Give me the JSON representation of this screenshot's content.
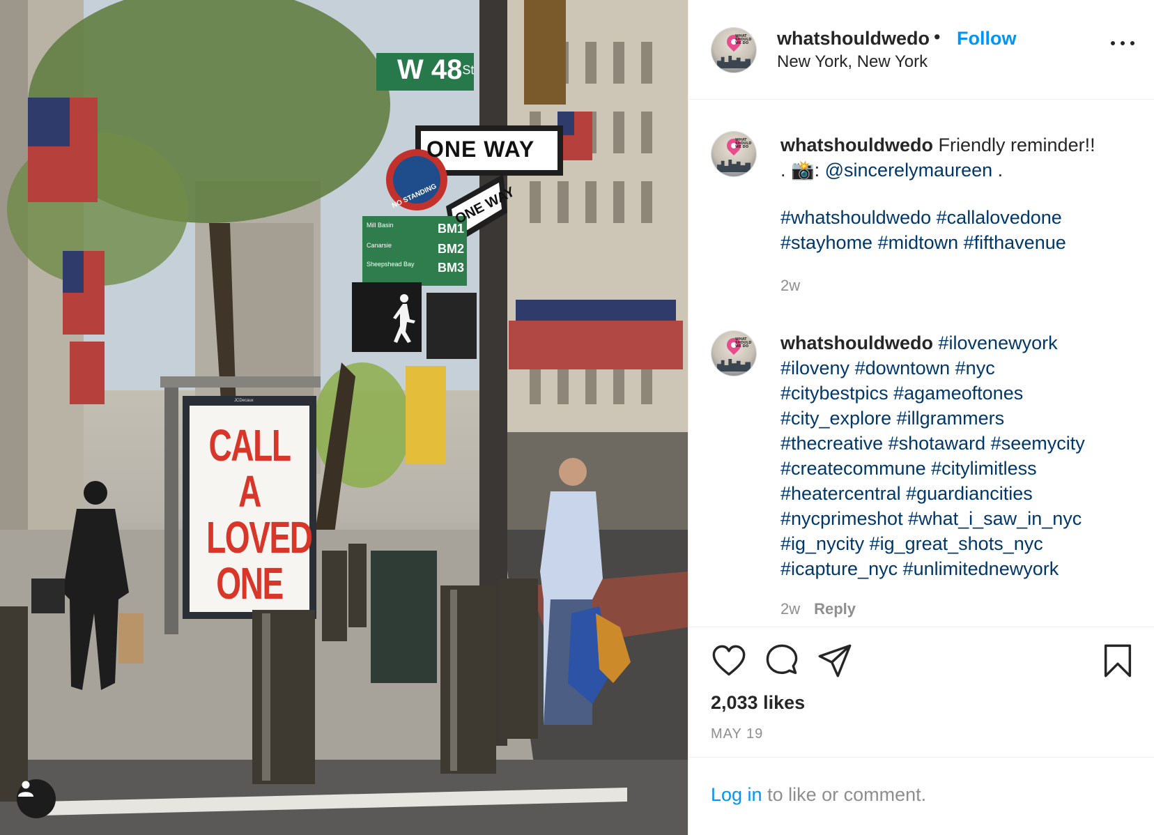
{
  "post": {
    "username": "whatshouldwedo",
    "separator": "•",
    "follow_label": "Follow",
    "location": "New York, New York",
    "avatar_text": [
      "WHAT",
      "SHOULD",
      "WE DO"
    ]
  },
  "photo": {
    "street_sign": "W 48",
    "street_sign_suffix": "St",
    "one_way_1": "ONE WAY",
    "one_way_2": "ONE WAY",
    "no_standing": "NO STANDING",
    "bus_stops": [
      "Mill Basin",
      "Canarsie",
      "Sheepshead Bay"
    ],
    "bus_routes": [
      "BM1",
      "BM2",
      "BM3"
    ],
    "poster_brand": "JCDecaux",
    "poster_lines": [
      "CALL",
      "A",
      "LOVED",
      "ONE"
    ]
  },
  "caption": {
    "username": "whatshouldwedo",
    "text_1": "Friendly reminder!!",
    "text_2_prefix": ". 📸: ",
    "mention": "@sincerelymaureen",
    "text_2_suffix": " .",
    "hashtags_1": "#whatshouldwedo #callalovedone",
    "hashtags_2": "#stayhome #midtown #fifthavenue",
    "age": "2w"
  },
  "comment": {
    "username": "whatshouldwedo",
    "lines": [
      "#ilovenewyork",
      "#iloveny #downtown #nyc",
      "#citybestpics #agameoftones",
      "#city_explore #illgrammers",
      "#thecreative #shotaward #seemycity",
      "#createcommune #citylimitless",
      "#heatercentral #guardiancities",
      "#nycprimeshot #what_i_saw_in_nyc",
      "#ig_nycity #ig_great_shots_nyc",
      "#icapture_nyc #unlimitednewyork"
    ],
    "age": "2w",
    "reply_label": "Reply"
  },
  "actions": {
    "likes": "2,033 likes",
    "date": "MAY 19",
    "icons": [
      "heart-icon",
      "comment-icon",
      "share-icon",
      "bookmark-icon"
    ]
  },
  "login": {
    "link": "Log in",
    "rest": " to like or comment."
  },
  "colors": {
    "link_blue": "#0095f6",
    "hashtag": "#00376b",
    "muted": "#8e8e8e",
    "poster_red": "#d9362a"
  }
}
